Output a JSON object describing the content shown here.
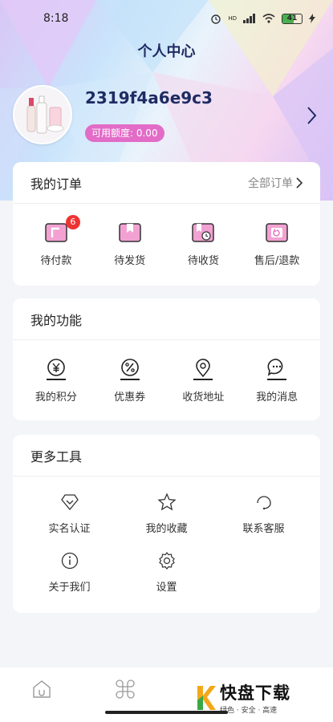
{
  "status_bar": {
    "time": "8:18",
    "battery": "41",
    "signal_tag": "HD"
  },
  "page": {
    "title": "个人中心"
  },
  "profile": {
    "username": "2319f4a6e9c3",
    "credit_label": "可用额度: 0.00"
  },
  "orders": {
    "title": "我的订单",
    "all_link": "全部订单",
    "items": [
      {
        "label": "待付款",
        "icon": "wallet-icon",
        "badge": "6"
      },
      {
        "label": "待发货",
        "icon": "package-icon"
      },
      {
        "label": "待收货",
        "icon": "delivery-clock-icon"
      },
      {
        "label": "售后/退款",
        "icon": "refund-icon"
      }
    ]
  },
  "functions": {
    "title": "我的功能",
    "items": [
      {
        "label": "我的积分",
        "icon": "yen-coin-icon"
      },
      {
        "label": "优惠券",
        "icon": "percent-coupon-icon"
      },
      {
        "label": "收货地址",
        "icon": "location-pin-icon"
      },
      {
        "label": "我的消息",
        "icon": "message-bubble-icon"
      }
    ]
  },
  "tools": {
    "title": "更多工具",
    "items": [
      {
        "label": "实名认证",
        "icon": "verified-diamond-icon"
      },
      {
        "label": "我的收藏",
        "icon": "star-icon"
      },
      {
        "label": "联系客服",
        "icon": "customer-service-icon"
      },
      {
        "label": "关于我们",
        "icon": "info-icon"
      },
      {
        "label": "设置",
        "icon": "gear-icon"
      }
    ]
  },
  "bottom_nav": {
    "items": [
      {
        "icon": "home-icon"
      },
      {
        "icon": "category-icon"
      }
    ]
  },
  "watermark": {
    "brand": "快盘下载",
    "slogan": "绿色 · 安全 · 高速"
  },
  "colors": {
    "accent_pink": "#e26cc7",
    "title_navy": "#1f2b63",
    "badge_red": "#ee3333"
  }
}
